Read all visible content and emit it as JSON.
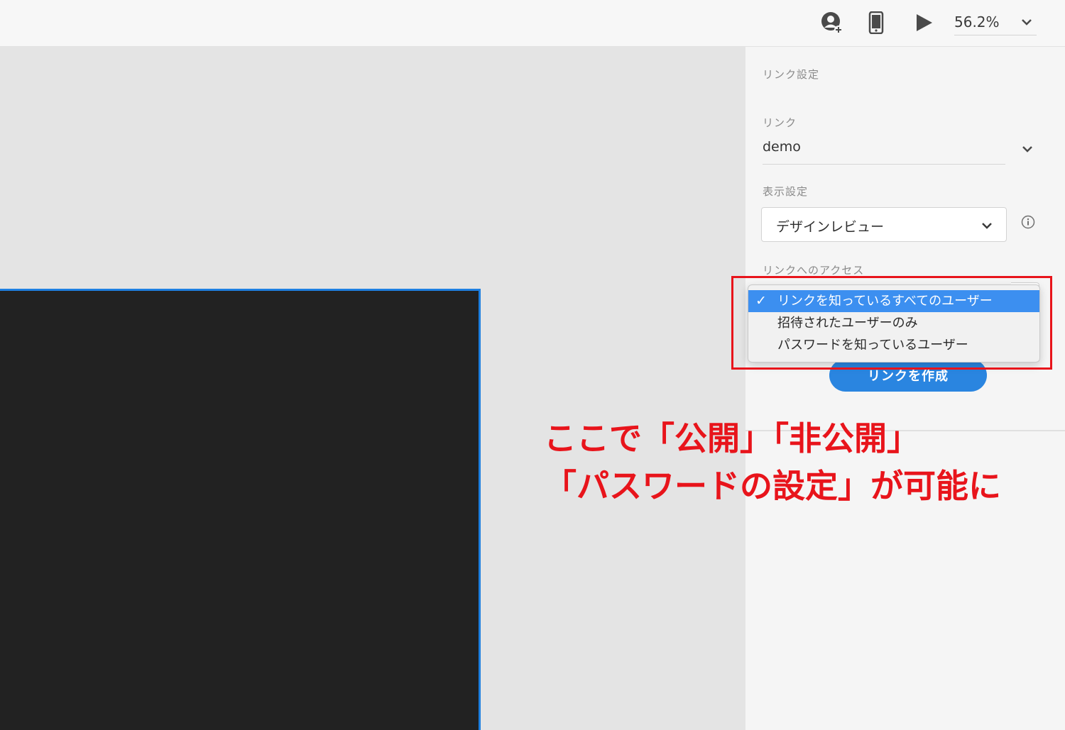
{
  "toolbar": {
    "zoom_value": "56.2%",
    "icons": [
      "invite-user-icon",
      "device-preview-icon",
      "play-icon",
      "chevron-down-icon"
    ]
  },
  "panel": {
    "title": "リンク設定",
    "link_label": "リンク",
    "link_value": "demo",
    "view_label": "表示設定",
    "view_value": "デザインレビュー",
    "access_label": "リンクへのアクセス",
    "create_button": "リンクを作成"
  },
  "access_dropdown": {
    "selected_index": 0,
    "options": [
      "リンクを知っているすべてのユーザー",
      "招待されたユーザーのみ",
      "パスワードを知っているユーザー"
    ]
  },
  "annotation": {
    "line1": "ここで「公開」「非公開」",
    "line2": "「パスワードの設定」が可能に"
  },
  "colors": {
    "accent": "#2a85e0",
    "selected_option": "#3c8ff0",
    "annotation_red": "#e8141b",
    "artboard": "#222222",
    "artboard_border": "#1e7fe0"
  }
}
